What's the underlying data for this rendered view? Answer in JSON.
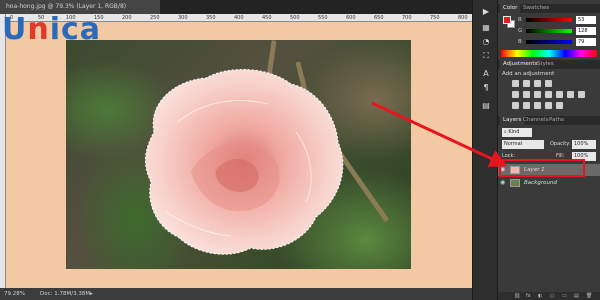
{
  "logo": {
    "brand": "Unica",
    "accent_letter": "n"
  },
  "document": {
    "tab_title": "hoa-hong.jpg @ 79.3% (Layer 1, RGB/8)",
    "tab_close": "×",
    "rulers_top": [
      "0",
      "50",
      "100",
      "150",
      "200",
      "250",
      "300",
      "350",
      "400",
      "450",
      "500",
      "550",
      "600",
      "650",
      "700",
      "750",
      "800"
    ]
  },
  "status": {
    "zoom": "79.28%",
    "doc": "Doc: 1.78M/3.38M",
    "arrow": "▸"
  },
  "color_panel": {
    "tabs": [
      "Color",
      "Swatches"
    ],
    "channels": [
      {
        "label": "R",
        "value": "53",
        "color": "#e02020"
      },
      {
        "label": "G",
        "value": "128",
        "color": "#20c020"
      },
      {
        "label": "B",
        "value": "79",
        "color": "#2040e0"
      }
    ]
  },
  "adjustments_panel": {
    "tabs": [
      "Adjustments",
      "Styles"
    ],
    "title": "Add an adjustment"
  },
  "layers_panel": {
    "tabs": [
      "Layers",
      "Channels",
      "Paths"
    ],
    "filter": "Kind",
    "blend_mode": "Normal",
    "opacity_label": "Opacity:",
    "opacity_value": "100%",
    "lock_label": "Lock:",
    "fill_label": "Fill:",
    "fill_value": "100%",
    "layers": [
      {
        "name": "Layer 1",
        "selected": true
      },
      {
        "name": "Background",
        "selected": false
      }
    ],
    "bottom_icons": [
      "⛓",
      "fx",
      "◐",
      "○",
      "▭",
      "▤",
      "🗑"
    ]
  },
  "toolbar_icons": [
    "▶",
    "▦",
    "◔",
    "⛶",
    "A",
    "¶",
    "▤",
    "▦"
  ],
  "annotation": {
    "arrow_color": "#e8141e",
    "highlight_color": "#e8141e"
  }
}
